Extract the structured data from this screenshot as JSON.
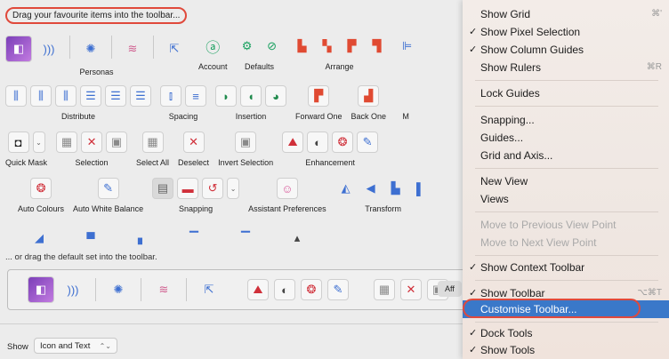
{
  "toolbar_customise": {
    "hint": "Drag your favourite items into the toolbar...",
    "row1": {
      "personas_label": "Personas",
      "account_label": "Account",
      "defaults_label": "Defaults",
      "arrange_label": "Arrange"
    },
    "row2": {
      "distribute_label": "Distribute",
      "spacing_label": "Spacing",
      "insertion_label": "Insertion",
      "forward_one_label": "Forward One",
      "back_one_label": "Back One",
      "m_label": "M"
    },
    "row3": {
      "quick_mask_label": "Quick Mask",
      "selection_label": "Selection",
      "select_all_label": "Select All",
      "deselect_label": "Deselect",
      "invert_selection_label": "Invert Selection",
      "enhancement_label": "Enhancement"
    },
    "row4": {
      "auto_colours_label": "Auto Colours",
      "auto_white_balance_label": "Auto White Balance",
      "snapping_label": "Snapping",
      "assistant_preferences_label": "Assistant Preferences",
      "transform_label": "Transform"
    },
    "default_set_text": "... or drag the default set into the toolbar.",
    "default_set_partial_label": "Aff",
    "show_label": "Show",
    "show_value": "Icon and Text"
  },
  "menu": {
    "items": [
      {
        "label": "Show Grid",
        "checked": false,
        "shortcut": "⌘'"
      },
      {
        "label": "Show Pixel Selection",
        "checked": true,
        "shortcut": ""
      },
      {
        "label": "Show Column Guides",
        "checked": true,
        "shortcut": ""
      },
      {
        "label": "Show Rulers",
        "checked": false,
        "shortcut": "⌘R"
      },
      {
        "label": "Lock Guides",
        "checked": false,
        "shortcut": ""
      },
      {
        "label": "Snapping...",
        "checked": false,
        "shortcut": ""
      },
      {
        "label": "Guides...",
        "checked": false,
        "shortcut": ""
      },
      {
        "label": "Grid and Axis...",
        "checked": false,
        "shortcut": ""
      },
      {
        "label": "New View",
        "checked": false,
        "shortcut": ""
      },
      {
        "label": "Views",
        "checked": false,
        "shortcut": ""
      },
      {
        "label": "Move to Previous View Point",
        "checked": false,
        "shortcut": ""
      },
      {
        "label": "Move to Next View Point",
        "checked": false,
        "shortcut": ""
      },
      {
        "label": "Show Context Toolbar",
        "checked": true,
        "shortcut": ""
      },
      {
        "label": "Show Toolbar",
        "checked": true,
        "shortcut": "⌥⌘T"
      },
      {
        "label": "Customise Toolbar...",
        "checked": false,
        "shortcut": ""
      },
      {
        "label": "Dock Tools",
        "checked": true,
        "shortcut": ""
      },
      {
        "label": "Show Tools",
        "checked": true,
        "shortcut": ""
      }
    ],
    "check_glyph": "✓"
  },
  "colors": {
    "highlight": "#3a78c9",
    "annotation_ring": "#e0493b"
  }
}
